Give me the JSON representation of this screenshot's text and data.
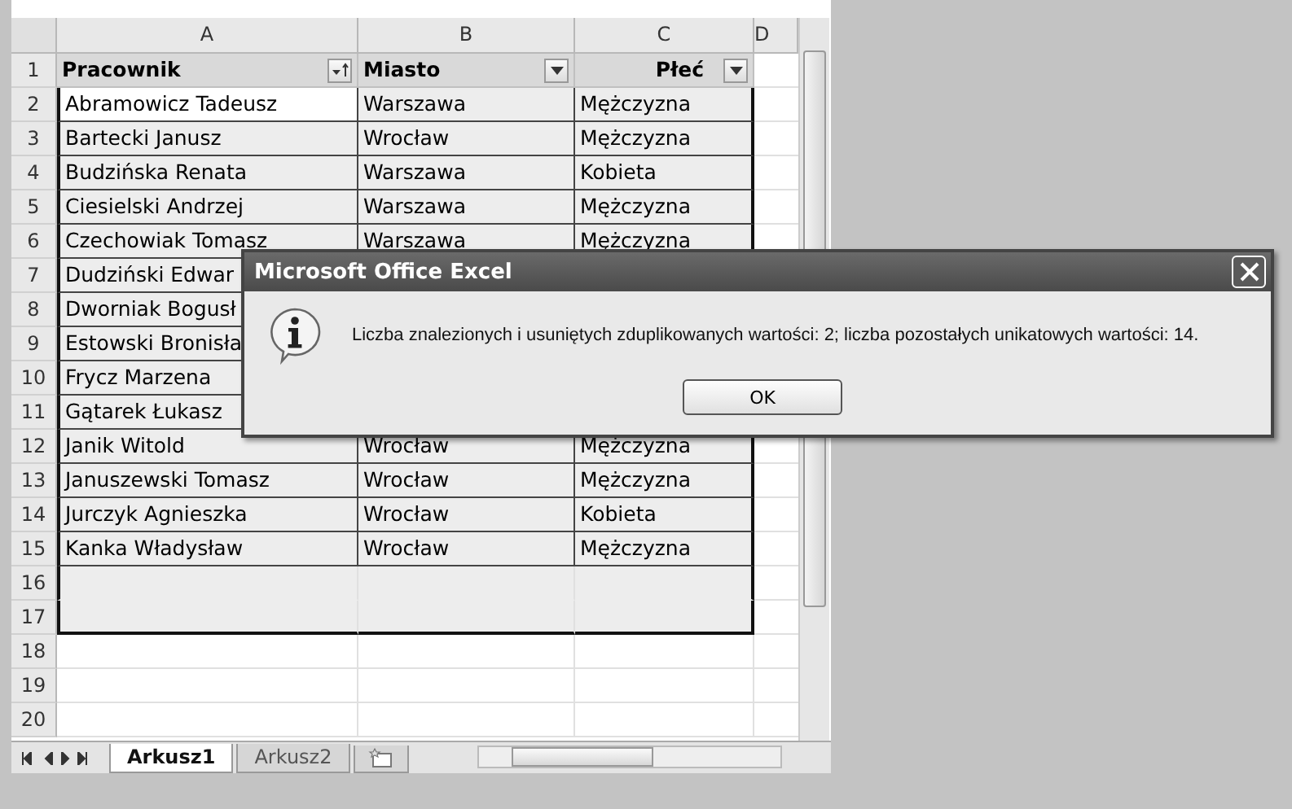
{
  "sheet": {
    "columns": [
      {
        "label": "A"
      },
      {
        "label": "B"
      },
      {
        "label": "C"
      },
      {
        "label": "D"
      }
    ],
    "header_row": {
      "number": "1",
      "cells": [
        {
          "text": "Pracownik",
          "kind": "sorted"
        },
        {
          "text": "Miasto",
          "kind": "filter"
        },
        {
          "text": "Płeć",
          "kind": "filter"
        }
      ]
    },
    "rows": [
      {
        "number": "2",
        "active": true,
        "in_selection": true,
        "cells": [
          "Abramowicz Tadeusz",
          "Warszawa",
          "Mężczyzna"
        ]
      },
      {
        "number": "3",
        "active": false,
        "in_selection": true,
        "cells": [
          "Bartecki Janusz",
          "Wrocław",
          "Mężczyzna"
        ]
      },
      {
        "number": "4",
        "active": false,
        "in_selection": true,
        "cells": [
          "Budzińska Renata",
          "Warszawa",
          "Kobieta"
        ]
      },
      {
        "number": "5",
        "active": false,
        "in_selection": true,
        "cells": [
          "Ciesielski Andrzej",
          "Warszawa",
          "Mężczyzna"
        ]
      },
      {
        "number": "6",
        "active": false,
        "in_selection": true,
        "cells": [
          "Czechowiak Tomasz",
          "Warszawa",
          "Mężczyzna"
        ]
      },
      {
        "number": "7",
        "active": false,
        "in_selection": true,
        "cells": [
          "Dudziński Edwar"
        ]
      },
      {
        "number": "8",
        "active": false,
        "in_selection": true,
        "cells": [
          "Dworniak Bogusł"
        ]
      },
      {
        "number": "9",
        "active": false,
        "in_selection": true,
        "cells": [
          "Estowski Bronisła"
        ]
      },
      {
        "number": "10",
        "active": false,
        "in_selection": true,
        "cells": [
          "Frycz Marzena"
        ]
      },
      {
        "number": "11",
        "active": false,
        "in_selection": true,
        "cells": [
          "Gątarek Łukasz"
        ]
      },
      {
        "number": "12",
        "active": false,
        "in_selection": true,
        "cells": [
          "Janik Witold",
          "Wrocław",
          "Mężczyzna"
        ]
      },
      {
        "number": "13",
        "active": false,
        "in_selection": true,
        "cells": [
          "Januszewski Tomasz",
          "Wrocław",
          "Mężczyzna"
        ]
      },
      {
        "number": "14",
        "active": false,
        "in_selection": true,
        "cells": [
          "Jurczyk Agnieszka",
          "Wrocław",
          "Kobieta"
        ]
      },
      {
        "number": "15",
        "active": false,
        "in_selection": true,
        "cells": [
          "Kanka Władysław",
          "Wrocław",
          "Mężczyzna"
        ]
      },
      {
        "number": "16",
        "active": false,
        "in_selection": true
      },
      {
        "number": "17",
        "active": false,
        "in_selection": true
      },
      {
        "number": "18",
        "in_selection": false
      },
      {
        "number": "19",
        "in_selection": false
      },
      {
        "number": "20",
        "in_selection": false
      }
    ],
    "tabs": [
      {
        "label": "Arkusz1",
        "selected": true
      },
      {
        "label": "Arkusz2",
        "selected": false
      }
    ]
  },
  "dialog": {
    "title": "Microsoft Office Excel",
    "message": "Liczba znalezionych i usuniętych zduplikowanych wartości: 2; liczba pozostałych unikatowych wartości: 14.",
    "button": "OK"
  }
}
